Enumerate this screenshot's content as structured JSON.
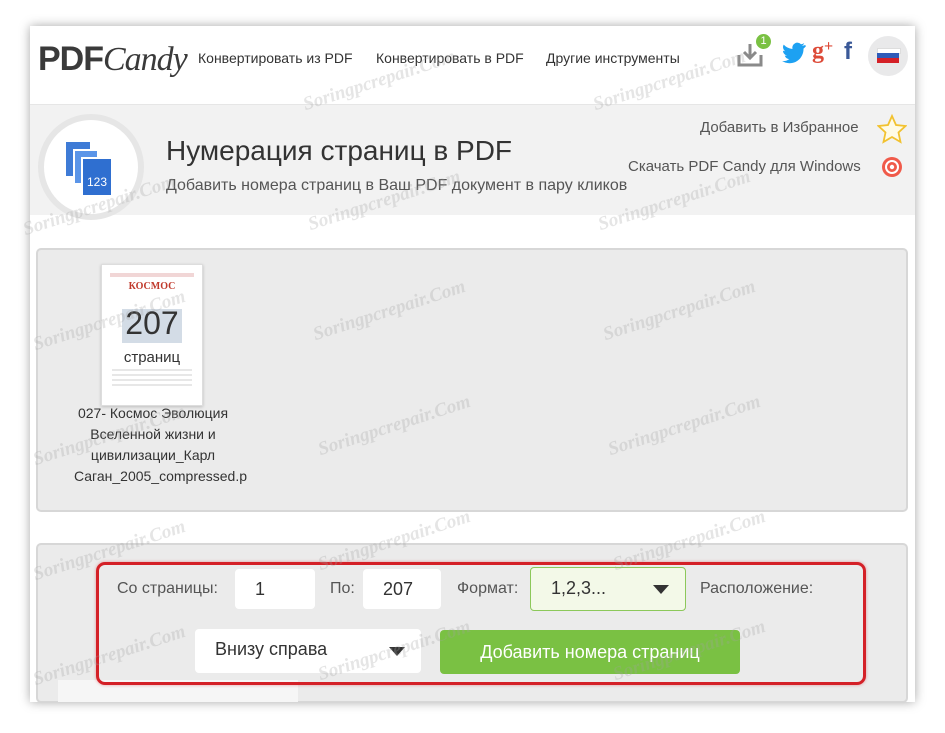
{
  "logo": {
    "pdf": "PDF",
    "candy": "Candy"
  },
  "nav": {
    "convert_from": "Конвертировать из PDF",
    "convert_to": "Конвертировать в PDF",
    "other_tools": "Другие инструменты"
  },
  "badge": {
    "count": "1"
  },
  "icons": [
    "download-icon",
    "twitter-icon",
    "google-plus-icon",
    "facebook-icon",
    "russia-flag-icon",
    "star-icon",
    "windows-app-icon",
    "pages-123-icon"
  ],
  "hero": {
    "title": "Нумерация страниц в PDF",
    "subtitle": "Добавить номера страниц в Ваш PDF документ в пару кликов",
    "favorite_link": "Добавить в Избранное",
    "windows_link": "Скачать PDF Candy для Windows",
    "icon_text": "123"
  },
  "file": {
    "page_count": "207",
    "page_label": "страниц",
    "name_lines": [
      "027- Космос Эволюция",
      "Вселенной жизни и",
      "цивилизации_Карл",
      "Саган_2005_compressed.p"
    ],
    "thumb_title": "КОСМОС"
  },
  "form": {
    "from_label": "Со страницы:",
    "from_value": "1",
    "to_label": "По:",
    "to_value": "207",
    "format_label": "Формат:",
    "format_value": "1,2,3...",
    "position_label": "Расположение:",
    "position_value": "Внизу справа",
    "submit_label": "Добавить номера страниц"
  },
  "colors": {
    "accent_green": "#7ac143",
    "highlight_red": "#d42027",
    "twitter_blue": "#1da1f2",
    "gplus_red": "#dd4b39",
    "facebook_blue": "#3b5998"
  },
  "watermark": "Soringpcrepair.Com"
}
